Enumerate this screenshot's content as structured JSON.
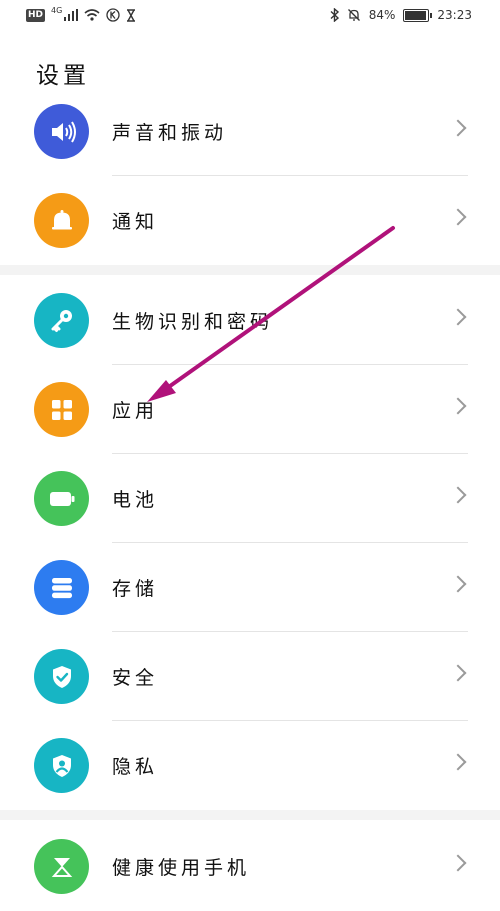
{
  "status_bar": {
    "hd_badge": "HD",
    "network_type": "4G",
    "battery_percent": "84%",
    "battery_level": 0.84,
    "time": "23:23",
    "icons": [
      "hd-icon",
      "signal-icon",
      "wifi-icon",
      "k-icon",
      "hourglass-icon",
      "bluetooth-icon",
      "mute-bell-icon",
      "battery-icon"
    ]
  },
  "header": {
    "title": "设置"
  },
  "settings": {
    "group1": [
      {
        "label": "声音和振动",
        "icon": "speaker-icon",
        "color": "#3F5BD9"
      },
      {
        "label": "通知",
        "icon": "bell-icon",
        "color": "#F59B16"
      }
    ],
    "group2": [
      {
        "label": "生物识别和密码",
        "icon": "key-icon",
        "color": "#17B5C4"
      },
      {
        "label": "应用",
        "icon": "apps-grid-icon",
        "color": "#F59B16"
      },
      {
        "label": "电池",
        "icon": "battery-icon",
        "color": "#45C35A"
      },
      {
        "label": "存储",
        "icon": "storage-icon",
        "color": "#2D7CF0"
      },
      {
        "label": "安全",
        "icon": "shield-check-icon",
        "color": "#17B5C4"
      },
      {
        "label": "隐私",
        "icon": "privacy-shield-icon",
        "color": "#17B5C4"
      }
    ],
    "group3": [
      {
        "label": "健康使用手机",
        "icon": "hourglass-icon",
        "color": "#45C35A"
      }
    ]
  },
  "annotation": {
    "arrow_color": "#B0127A"
  }
}
